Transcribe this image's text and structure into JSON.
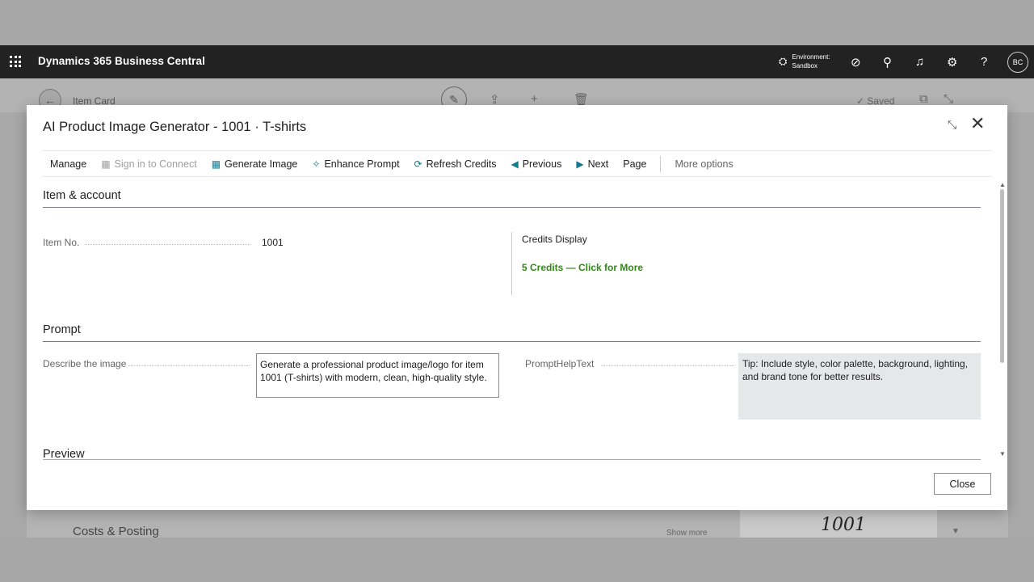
{
  "suitebar": {
    "app_title": "Dynamics 365 Business Central",
    "environment_label": "Environment:",
    "environment_name": "Sandbox",
    "avatar_initials": "BC"
  },
  "background_page": {
    "title": "Item Card",
    "saved_label": "✓ Saved",
    "costs_section": "Costs & Posting",
    "show_more": "Show more",
    "image_text": "1001"
  },
  "dialog": {
    "title": "AI Product Image Generator - 1001 · T-shirts",
    "actions": [
      {
        "label": "Manage",
        "icon": "",
        "state": "normal"
      },
      {
        "label": "Sign in to Connect",
        "icon": "connect-icon",
        "state": "disabled"
      },
      {
        "label": "Generate Image",
        "icon": "calculator-icon",
        "state": "normal"
      },
      {
        "label": "Enhance Prompt",
        "icon": "sparkle-icon",
        "state": "normal"
      },
      {
        "label": "Refresh Credits",
        "icon": "refresh-icon",
        "state": "normal"
      },
      {
        "label": "Previous",
        "icon": "arrow-left-icon",
        "state": "normal"
      },
      {
        "label": "Next",
        "icon": "arrow-right-icon",
        "state": "normal"
      },
      {
        "label": "Page",
        "icon": "",
        "state": "normal"
      },
      {
        "label": "More options",
        "icon": "",
        "state": "muted"
      }
    ],
    "sections": {
      "item_account": {
        "title": "Item & account",
        "item_no_label": "Item No.",
        "item_no_value": "1001",
        "credits_display_label": "Credits Display",
        "credits_value": "5 Credits — Click for More"
      },
      "prompt": {
        "title": "Prompt",
        "describe_label": "Describe the image",
        "describe_value": "Generate a professional product image/logo for item 1001 (T-shirts) with modern, clean, high-quality style.",
        "help_label": "PromptHelpText",
        "help_value": "Tip: Include style, color palette, background, lighting, and brand tone for better results."
      },
      "preview": {
        "title": "Preview"
      }
    },
    "close_label": "Close"
  },
  "colors": {
    "suitebar_bg": "#222222",
    "accent": "#117a8b",
    "credits_green": "#2e8b14",
    "help_bg": "#e6e7e9"
  }
}
